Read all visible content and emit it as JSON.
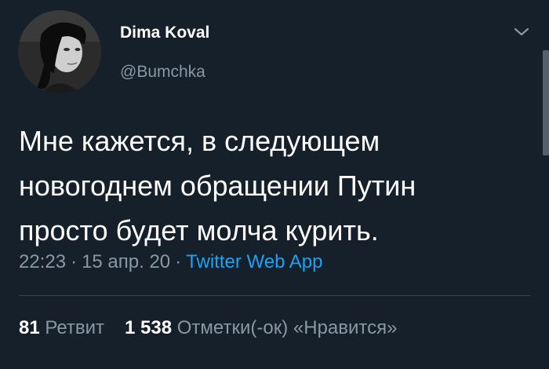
{
  "author": {
    "display_name": "Dima Koval",
    "handle": "@Bumchka",
    "avatar_icon": "user-avatar-photo"
  },
  "menu": {
    "icon": "chevron-down-icon"
  },
  "tweet": {
    "lines": [
      "Мне кажется, в следующем",
      "новогоднем обращении Путин",
      "просто будет молча курить."
    ]
  },
  "meta": {
    "time": "22:23",
    "separator": "·",
    "date": "15 апр. 20",
    "source": "Twitter Web App"
  },
  "stats": {
    "retweets_count": "81",
    "retweets_label": "Ретвит",
    "likes_count": "1 538",
    "likes_label": "Отметки(-ок) «Нравится»"
  },
  "colors": {
    "background": "#15202b",
    "text_primary": "#ffffff",
    "text_secondary": "#8899a6",
    "link": "#1da1f2",
    "divider": "#38444d"
  }
}
